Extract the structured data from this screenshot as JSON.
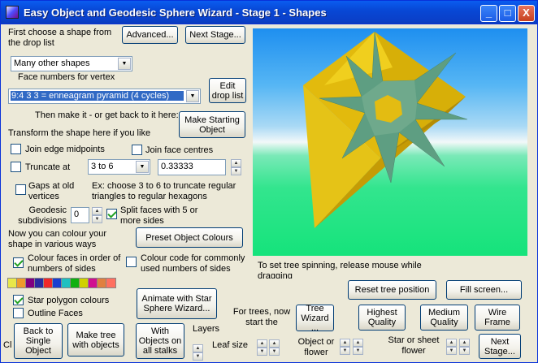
{
  "window": {
    "title": "Easy Object  and Geodesic Sphere Wizard - Stage 1 -  Shapes",
    "buttons": {
      "minimize": "_",
      "maximize": "□",
      "close": "X"
    }
  },
  "instructions": {
    "choose_shape": "First choose a shape from the drop list",
    "face_numbers": "Face numbers for vertex",
    "make_it": "Then make it - or get back to it here:",
    "transform": "Transform the shape here if you like",
    "truncate_example": "Ex: choose 3 to 6 to truncate regular triangles to regular hexagons",
    "colour_shape": "Now you can colour your shape in various ways",
    "spin_hint": "To set tree spinning, release mouse while dragging",
    "for_trees": "For trees, now start the"
  },
  "buttons": {
    "advanced": "Advanced...",
    "next_stage_top": "Next Stage...",
    "edit_drop_list": "Edit drop list",
    "make_starting_object": "Make Starting Object",
    "preset_colours": "Preset Object Colours",
    "animate_star": "Animate with Star Sphere Wizard...",
    "reset_tree": "Reset tree position",
    "fill_screen": "Fill screen...",
    "back_single": "Back to Single Object",
    "make_tree": "Make tree with objects",
    "with_objects": "With Objects on all stalks",
    "tree_wizard": "Tree Wizard ...",
    "high_quality": "Highest Quality",
    "medium_quality": "Medium Quality",
    "wire_frame": "Wire Frame",
    "next_stage_bottom": "Next Stage..."
  },
  "combos": {
    "shape_category": "Many other shapes",
    "vertex_faces": "9:4 3 3  = enneagram pyramid (4 cycles)",
    "truncate": "3 to 6"
  },
  "fields": {
    "truncate_value": "0.33333",
    "geodesic_value": "0"
  },
  "checkboxes": {
    "join_edge": {
      "label": "Join edge midpoints",
      "checked": false
    },
    "join_face": {
      "label": "Join face centres",
      "checked": false
    },
    "truncate": {
      "label": "Truncate at",
      "checked": false
    },
    "gaps": {
      "label": "Gaps at old vertices",
      "checked": false
    },
    "split_faces": {
      "label": "Split faces with 5 or more sides",
      "checked": true
    },
    "colour_faces": {
      "label": "Colour faces in order of numbers of sides",
      "checked": true
    },
    "colour_code": {
      "label": "Colour code for commonly used numbers of sides",
      "checked": false
    },
    "star_polygon": {
      "label": "Star polygon colours",
      "checked": true
    },
    "outline_faces": {
      "label": "Outline Faces",
      "checked": false
    }
  },
  "labels": {
    "geodesic": "Geodesic subdivisions",
    "layers": "Layers",
    "leaf_size": "Leaf size",
    "object_flower": "Object or flower",
    "star_flower": "Star or sheet flower",
    "clipped_cl": "Cl"
  },
  "palette": [
    "#E8E84A",
    "#EE9A2C",
    "#800080",
    "#2A2AA0",
    "#F02828",
    "#1A3FD0",
    "#20C0C0",
    "#10B010",
    "#D0D000",
    "#D01090",
    "#E08040",
    "#FF7060"
  ],
  "scene_colors": {
    "face_yellow": "#E7C00F",
    "face_dark": "#C69D06",
    "star_green": "#5E9E82"
  }
}
